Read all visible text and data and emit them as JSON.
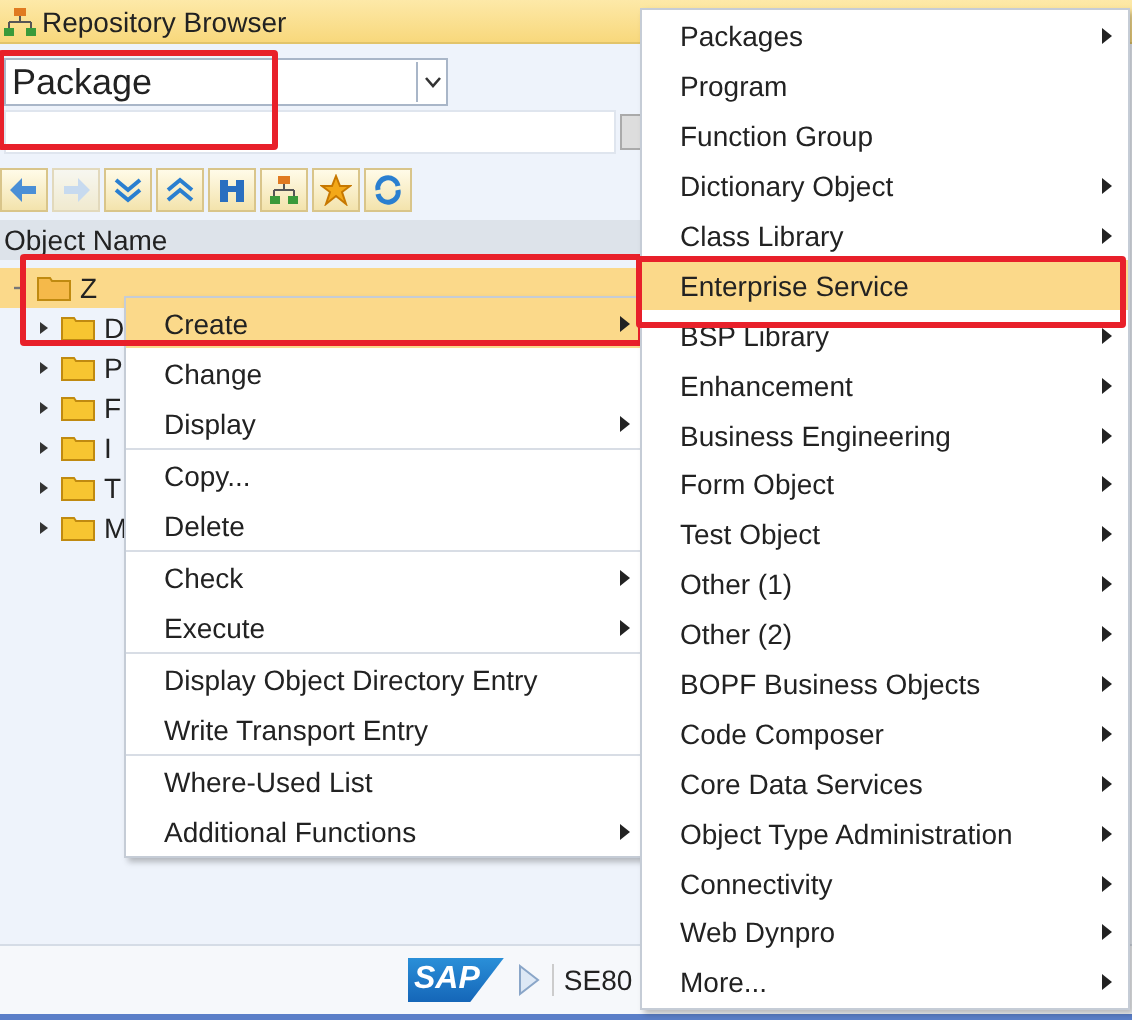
{
  "window": {
    "title": "Repository Browser"
  },
  "object_selector": {
    "value": "Package",
    "highlighted": true
  },
  "toolbar": {
    "buttons": [
      {
        "kind": "back",
        "disabled": false
      },
      {
        "kind": "forward",
        "disabled": true
      },
      {
        "kind": "expand"
      },
      {
        "kind": "collapse"
      },
      {
        "kind": "find"
      },
      {
        "kind": "hierarchy"
      },
      {
        "kind": "favorites"
      },
      {
        "kind": "refresh"
      }
    ]
  },
  "tree": {
    "header": "Object Name",
    "root": {
      "label": "Z",
      "expanded": true,
      "selected": true,
      "children": [
        {
          "label": "D",
          "expanded": false
        },
        {
          "label": "P",
          "expanded": false
        },
        {
          "label": "F",
          "expanded": false
        },
        {
          "label": "I",
          "expanded": false
        },
        {
          "label": "T",
          "expanded": false
        },
        {
          "label": "M",
          "expanded": false
        }
      ]
    }
  },
  "context_menu": {
    "groups": [
      [
        {
          "label": "Create",
          "submenu": true,
          "selected": true,
          "highlighted": true
        },
        {
          "label": "Change",
          "submenu": false,
          "selected": false
        },
        {
          "label": "Display",
          "submenu": true,
          "selected": false
        }
      ],
      [
        {
          "label": "Copy...",
          "submenu": false,
          "selected": false
        },
        {
          "label": "Delete",
          "submenu": false,
          "selected": false
        }
      ],
      [
        {
          "label": "Check",
          "submenu": true,
          "selected": false
        },
        {
          "label": "Execute",
          "submenu": true,
          "selected": false
        }
      ],
      [
        {
          "label": "Display Object Directory Entry",
          "submenu": false,
          "selected": false
        },
        {
          "label": "Write Transport Entry",
          "submenu": false,
          "selected": false
        }
      ],
      [
        {
          "label": "Where-Used List",
          "submenu": false,
          "selected": false
        },
        {
          "label": "Additional Functions",
          "submenu": true,
          "selected": false
        }
      ]
    ]
  },
  "create_submenu": [
    {
      "label": "Packages",
      "submenu": true,
      "selected": false
    },
    {
      "label": "Program",
      "submenu": false,
      "selected": false
    },
    {
      "label": "Function Group",
      "submenu": false,
      "selected": false
    },
    {
      "label": "Dictionary Object",
      "submenu": true,
      "selected": false
    },
    {
      "label": "Class Library",
      "submenu": true,
      "selected": false
    },
    {
      "label": "Enterprise Service",
      "submenu": false,
      "selected": true,
      "highlighted": true
    },
    {
      "label": "BSP Library",
      "submenu": true,
      "selected": false
    },
    {
      "label": "Enhancement",
      "submenu": true,
      "selected": false
    },
    {
      "label": "Business Engineering",
      "submenu": true,
      "selected": false
    },
    {
      "label": "Form Object",
      "submenu": true,
      "selected": false
    },
    {
      "label": "Test Object",
      "submenu": true,
      "selected": false
    },
    {
      "label": "Other (1)",
      "submenu": true,
      "selected": false
    },
    {
      "label": "Other (2)",
      "submenu": true,
      "selected": false
    },
    {
      "label": "BOPF Business Objects",
      "submenu": true,
      "selected": false
    },
    {
      "label": "Code Composer",
      "submenu": true,
      "selected": false
    },
    {
      "label": "Core Data Services",
      "submenu": true,
      "selected": false
    },
    {
      "label": "Object Type Administration",
      "submenu": true,
      "selected": false
    },
    {
      "label": "Connectivity",
      "submenu": true,
      "selected": false
    },
    {
      "label": "Web Dynpro",
      "submenu": true,
      "selected": false
    },
    {
      "label": "More...",
      "submenu": true,
      "selected": false
    }
  ],
  "status_bar": {
    "logo": "SAP",
    "transaction": "SE80"
  }
}
